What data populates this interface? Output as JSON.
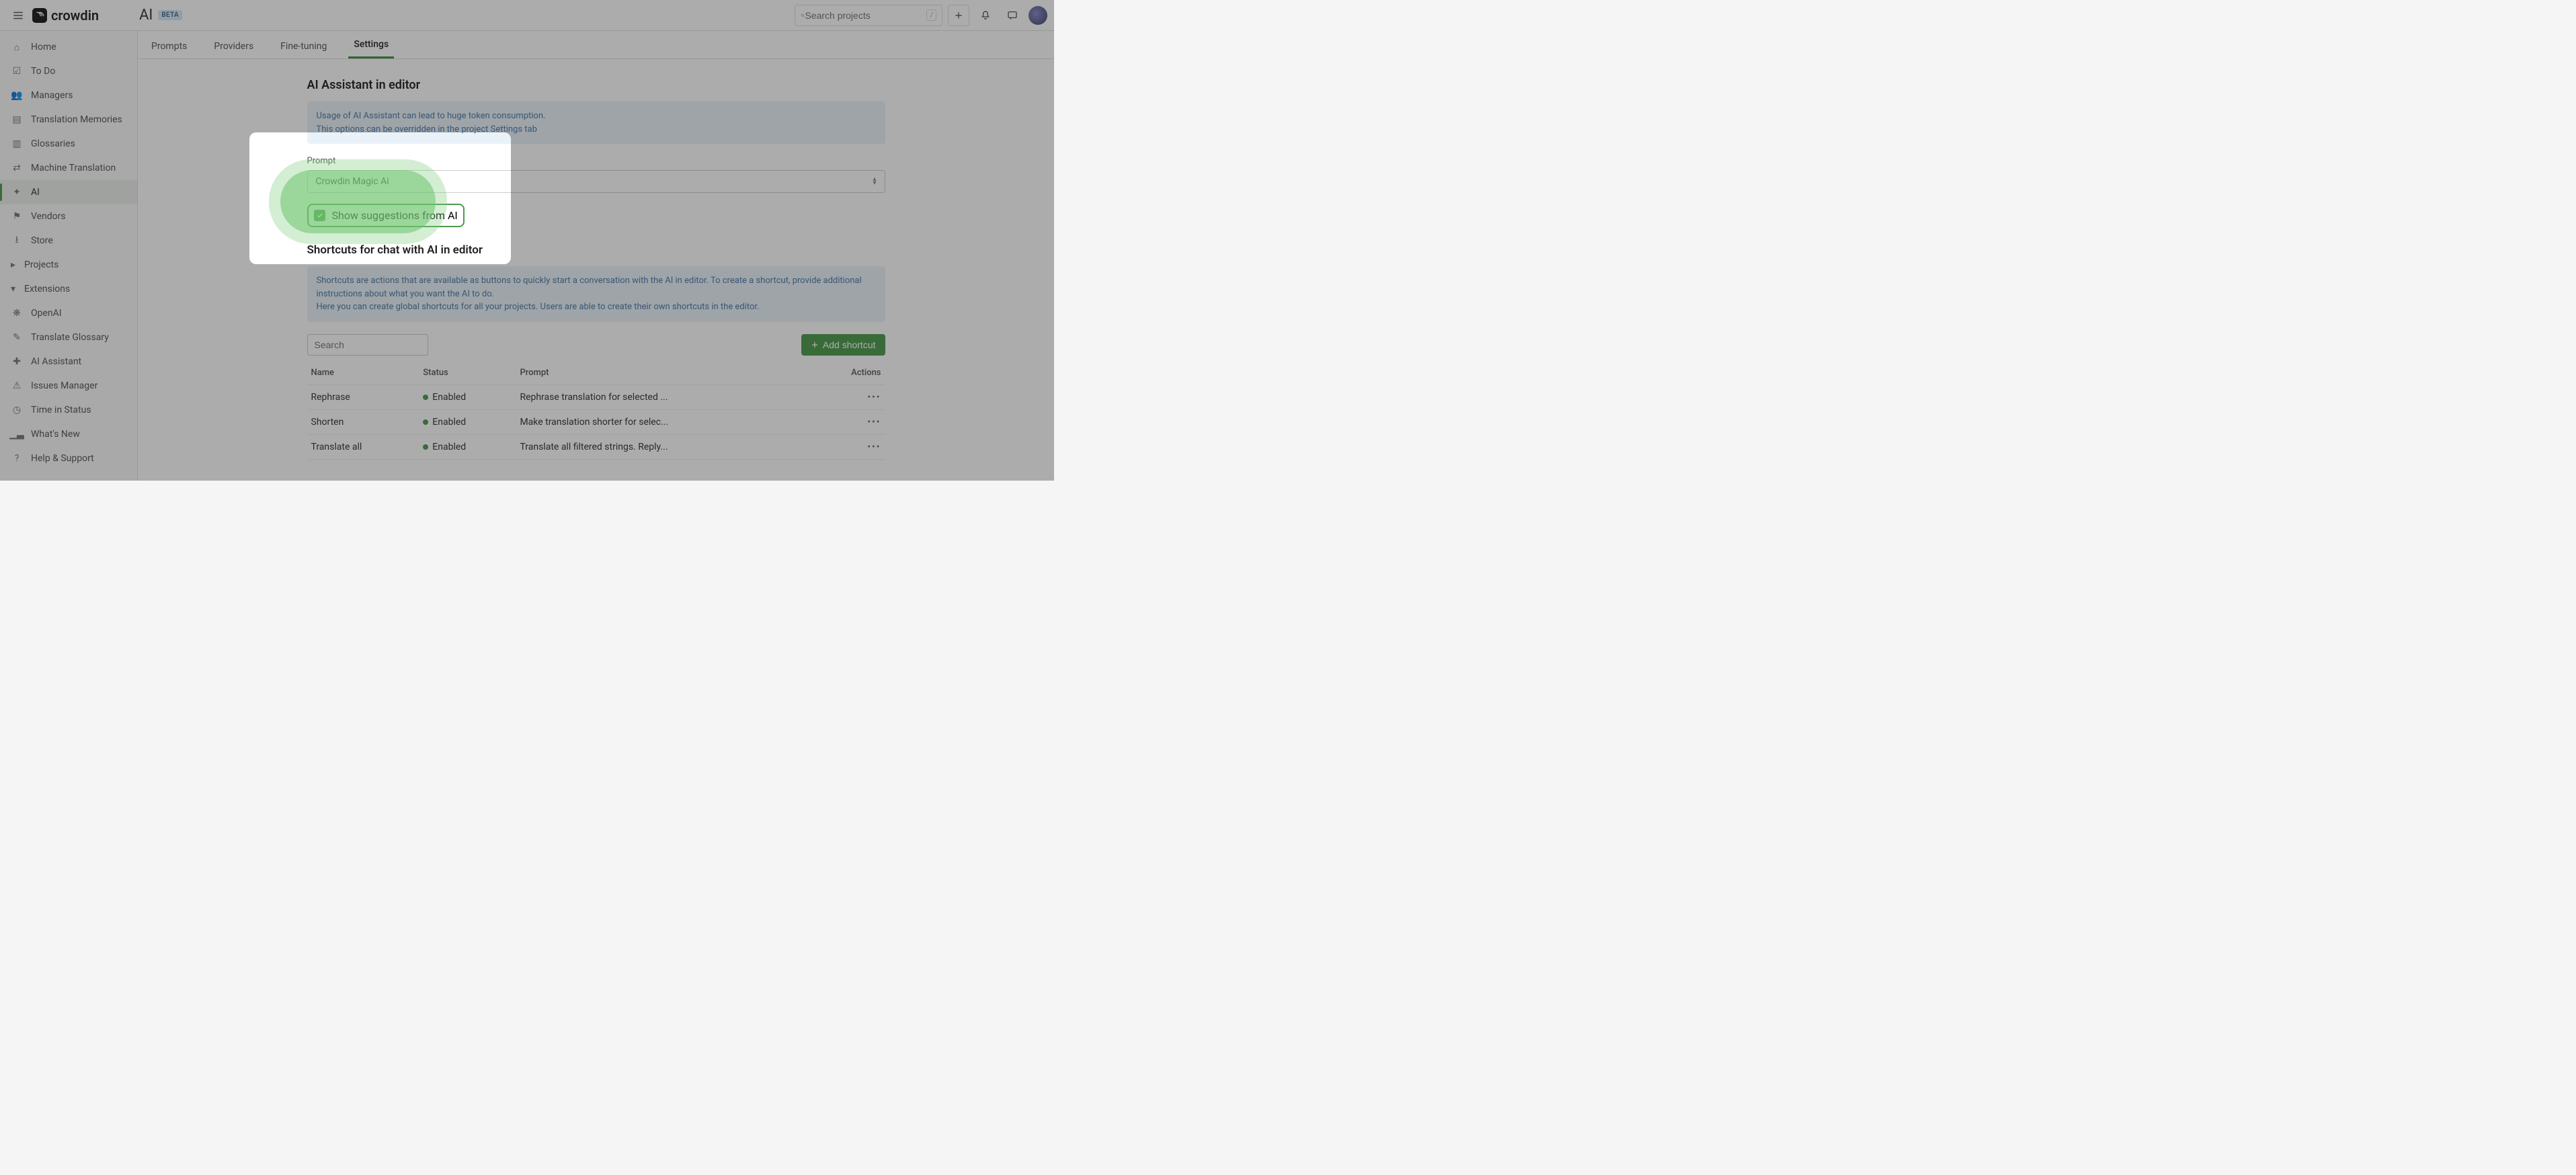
{
  "app": {
    "name": "crowdin"
  },
  "header": {
    "title": "AI",
    "badge": "BETA",
    "search_placeholder": "Search projects",
    "search_kbd": "/"
  },
  "sidebar": {
    "items": [
      {
        "label": "Home",
        "icon": "home-icon"
      },
      {
        "label": "To Do",
        "icon": "checkbox-icon"
      },
      {
        "label": "Managers",
        "icon": "people-icon"
      },
      {
        "label": "Translation Memories",
        "icon": "book-icon"
      },
      {
        "label": "Glossaries",
        "icon": "book2-icon"
      },
      {
        "label": "Machine Translation",
        "icon": "translate-icon"
      },
      {
        "label": "AI",
        "icon": "sparkle-icon",
        "active": true
      },
      {
        "label": "Vendors",
        "icon": "store-icon"
      },
      {
        "label": "Store",
        "icon": "download-icon"
      }
    ],
    "section_projects": "Projects",
    "section_extensions": "Extensions",
    "extensions": [
      {
        "label": "OpenAI",
        "icon": "openai-icon"
      },
      {
        "label": "Translate Glossary",
        "icon": "glossary-icon"
      },
      {
        "label": "AI Assistant",
        "icon": "assistant-icon"
      },
      {
        "label": "Issues Manager",
        "icon": "issues-icon"
      },
      {
        "label": "Time in Status",
        "icon": "clock-icon"
      },
      {
        "label": "What's New",
        "icon": "graph-icon"
      },
      {
        "label": "Help & Support",
        "icon": "help-icon"
      }
    ]
  },
  "tabs": [
    {
      "label": "Prompts"
    },
    {
      "label": "Providers"
    },
    {
      "label": "Fine-tuning"
    },
    {
      "label": "Settings",
      "active": true
    }
  ],
  "section1": {
    "heading": "AI Assistant in editor",
    "note1": "Usage of AI Assistant can lead to huge token consumption.",
    "note2": "This options can be overridden in the project Settings tab",
    "prompt_label": "Prompt",
    "prompt_value": "Crowdin Magic Ai",
    "checkbox_label": "Show suggestions from AI"
  },
  "section2": {
    "heading": "Shortcuts for chat with AI in editor",
    "note1": "Shortcuts are actions that are available as buttons to quickly start a conversation with the AI in editor. To create a shortcut, provide additional instructions about what you want the AI to do.",
    "note2": "Here you can create global shortcuts for all your projects. Users are able to create their own shortcuts in the editor.",
    "search_placeholder": "Search",
    "add_button": "Add shortcut",
    "columns": {
      "name": "Name",
      "status": "Status",
      "prompt": "Prompt",
      "actions": "Actions"
    },
    "status_enabled": "Enabled",
    "rows": [
      {
        "name": "Rephrase",
        "status": "Enabled",
        "prompt": "Rephrase translation for selected ..."
      },
      {
        "name": "Shorten",
        "status": "Enabled",
        "prompt": "Make translation shorter for selec..."
      },
      {
        "name": "Translate all",
        "status": "Enabled",
        "prompt": "Translate all filtered strings. Reply..."
      }
    ]
  }
}
